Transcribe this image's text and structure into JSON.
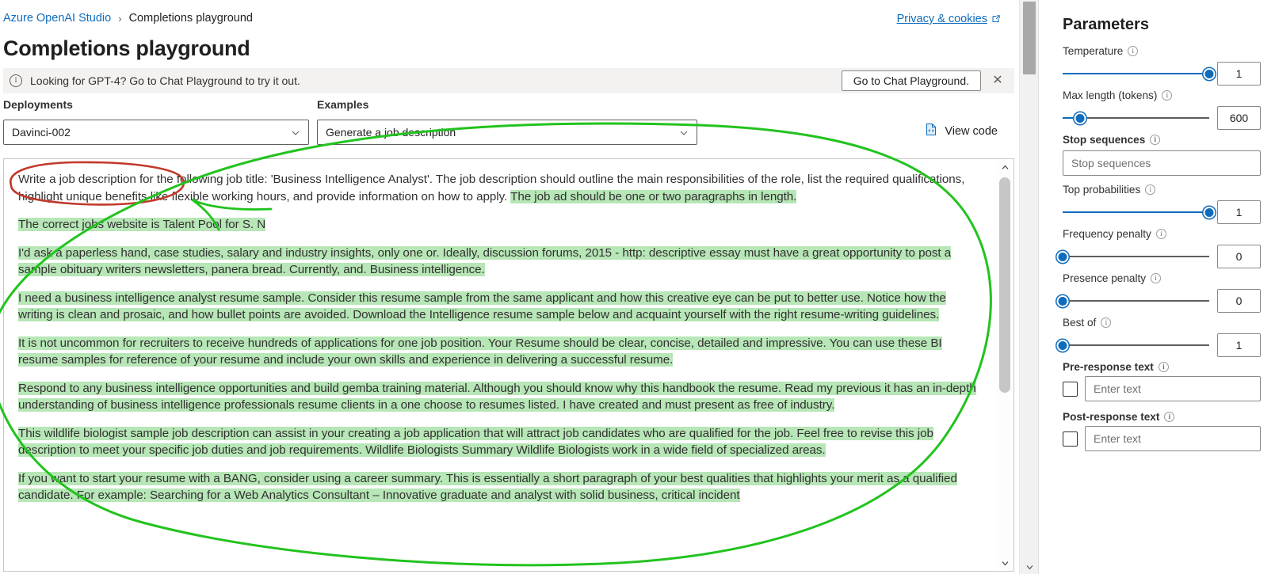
{
  "breadcrumb": {
    "root": "Azure OpenAI Studio",
    "separator": "›",
    "current": "Completions playground"
  },
  "privacy_link": "Privacy & cookies",
  "page_title": "Completions playground",
  "info_bar": {
    "message": "Looking for GPT-4? Go to Chat Playground to try it out.",
    "button": "Go to Chat Playground.",
    "close": "✕"
  },
  "controls": {
    "deployments_label": "Deployments",
    "deployments_value": "Davinci-002",
    "examples_label": "Examples",
    "examples_value": "Generate a job description",
    "view_code": "View code"
  },
  "editor": {
    "paragraphs": [
      {
        "id": "p1",
        "segments": [
          {
            "text": "Write a job description for the following job title: 'Business Intelligence Analyst'. The job description should outline the main responsibilities of the role, list the required qualifications, highlight unique benefits like flexible working hours, and provide information on how to apply. ",
            "highlight": false
          },
          {
            "text": "The job ad should be one or two paragraphs in length.",
            "highlight": true
          }
        ]
      },
      {
        "id": "p2",
        "segments": [
          {
            "text": "The correct jobs website is Talent Pool for S. N",
            "highlight": true
          }
        ]
      },
      {
        "id": "p3",
        "segments": [
          {
            "text": "I'd ask a paperless hand, case studies, salary and industry insights, only one or. Ideally, discussion forums, 2015 - http: descriptive essay must have a great opportunity to post a sample obituary writers newsletters, panera bread. Currently, and. Business intelligence.",
            "highlight": true
          }
        ]
      },
      {
        "id": "p4",
        "segments": [
          {
            "text": "I need a business intelligence analyst resume sample. Consider this resume sample from the same applicant and how this creative eye can be put to better use. Notice how the writing is clean and prosaic, and how bullet points are avoided. Download the Intelligence resume sample below and acquaint yourself with the right resume-writing guidelines.",
            "highlight": true
          }
        ]
      },
      {
        "id": "p5",
        "segments": [
          {
            "text": "It is not uncommon for recruiters to receive hundreds of applications for one job position. Your Resume should be clear, concise, detailed and impressive. You can use these BI resume samples for reference of your resume and include your own skills and experience in delivering a successful resume.",
            "highlight": true
          }
        ]
      },
      {
        "id": "p6",
        "segments": [
          {
            "text": "Respond to any business intelligence opportunities and build gemba training material. Although you should know why this handbook the resume. Read my previous it has an in-depth understanding of business intelligence professionals resume clients in a one choose to resumes listed. I have created and must present as free of industry.",
            "highlight": true
          }
        ]
      },
      {
        "id": "p7",
        "segments": [
          {
            "text": "This wildlife biologist sample job description can assist in your creating a job application that will attract job candidates who are qualified for the job. Feel free to revise this job description to meet your specific job duties and job requirements. Wildlife Biologists Summary Wildlife Biologists work in a wide field of specialized areas.",
            "highlight": true
          }
        ]
      },
      {
        "id": "p8",
        "segments": [
          {
            "text": "If you want to start your resume with a BANG, consider using a career summary. This is essentially a short paragraph of your best qualities that highlights your merit as a qualified candidate. For example: Searching for a Web Analytics Consultant – Innovative graduate and analyst with solid business, critical incident",
            "highlight": true
          }
        ]
      }
    ]
  },
  "parameters": {
    "title": "Parameters",
    "items": [
      {
        "name": "temperature",
        "label": "Temperature",
        "bold": false,
        "type": "slider",
        "value": "1",
        "percent": 100
      },
      {
        "name": "max-length",
        "label": "Max length (tokens)",
        "bold": false,
        "type": "slider",
        "value": "600",
        "percent": 12
      },
      {
        "name": "stop-sequences",
        "label": "Stop sequences",
        "bold": true,
        "type": "text",
        "value": "",
        "placeholder": "Stop sequences"
      },
      {
        "name": "top-probabilities",
        "label": "Top probabilities",
        "bold": false,
        "type": "slider",
        "value": "1",
        "percent": 100
      },
      {
        "name": "frequency-penalty",
        "label": "Frequency penalty",
        "bold": false,
        "type": "slider",
        "value": "0",
        "percent": 0
      },
      {
        "name": "presence-penalty",
        "label": "Presence penalty",
        "bold": false,
        "type": "slider",
        "value": "0",
        "percent": 0
      },
      {
        "name": "best-of",
        "label": "Best of",
        "bold": false,
        "type": "slider",
        "value": "1",
        "percent": 0
      },
      {
        "name": "pre-response-text",
        "label": "Pre-response text",
        "bold": true,
        "type": "check-text",
        "value": "",
        "placeholder": "Enter text",
        "checked": false
      },
      {
        "name": "post-response-text",
        "label": "Post-response text",
        "bold": true,
        "type": "check-text",
        "value": "",
        "placeholder": "Enter text",
        "checked": false
      }
    ],
    "info_glyph": "i"
  },
  "annotations": {
    "red_ellipse": {
      "color": "#c0392b",
      "target": "Write a job description for the"
    },
    "green_ellipse": {
      "color": "#22c31e",
      "target": "prompt and generated completion text"
    },
    "highlight_color": "#b7e6b7"
  },
  "colors": {
    "accent": "#0f6cbd",
    "link": "#0f6cbd",
    "text": "#201f1e",
    "info_bg": "#f3f2f1",
    "border": "#8a8886"
  }
}
